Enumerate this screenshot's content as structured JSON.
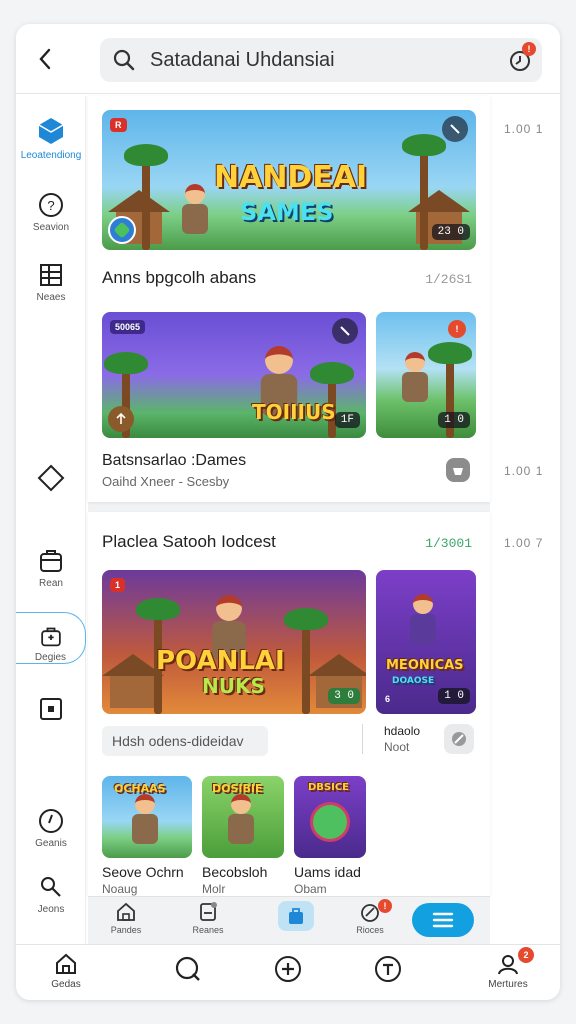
{
  "topbar": {
    "search_text": "Satadanai Uhdansiai"
  },
  "sidebar": {
    "items": [
      {
        "label": "Leoatendiong"
      },
      {
        "label": "Seavion"
      },
      {
        "label": "Neaes"
      },
      {
        "label": ""
      },
      {
        "label": "Rean"
      },
      {
        "label": "Degies"
      },
      {
        "label": ""
      },
      {
        "label": "Geanis"
      },
      {
        "label": "Jeons"
      }
    ]
  },
  "card1": {
    "hero": {
      "logo_line1": "NANDEAI",
      "logo_line2": "SAMES",
      "tag": "R",
      "counter": "23 0"
    },
    "title": "Anns bpgcolh abans",
    "meta": "1/26S1",
    "row2": {
      "tile_a": {
        "pill": "50065",
        "logo": "TOIIIUS",
        "counter": "1F"
      },
      "tile_b": {
        "counter": "1 0"
      }
    },
    "title2": "Batsnsarlao :Dames",
    "subtitle2": "Oaihd Xneer - Scesby"
  },
  "card2": {
    "title": "Placlea Satooh Iodcest",
    "meta": "1/3001",
    "hero": {
      "logo_line1": "POANLAI",
      "logo_line2": "NUKS",
      "tag": "1",
      "counter": "3 0"
    },
    "side": {
      "logo_line1": "MEONICAS",
      "logo_line2": "DOAOSE",
      "counter": "1 0",
      "num": "6"
    },
    "input_value": "Hdsh odens-dideidav",
    "side_label": "hdaolo",
    "side_sub": "Noot",
    "tiles": [
      {
        "logo": "OCHAAS",
        "title": "Seove Ochrn",
        "sub": "Noaug"
      },
      {
        "logo": "DOSIBIE",
        "title": "Becobsloh",
        "sub": "Molr"
      },
      {
        "logo": "DBSICE",
        "title": "Uams idad",
        "sub": "Obam"
      }
    ]
  },
  "dots": [
    "1.00 1",
    "1.00 1",
    "1.00 7"
  ],
  "innerbar": {
    "items": [
      {
        "label": "Pandes"
      },
      {
        "label": "Reanes"
      },
      {
        "label": ""
      },
      {
        "label": "Rioces"
      }
    ]
  },
  "bottomnav": {
    "items": [
      {
        "label": "Gedas"
      },
      {
        "label": ""
      },
      {
        "label": ""
      },
      {
        "label": ""
      },
      {
        "label": "Mertures"
      }
    ],
    "badge": "2"
  },
  "colors": {
    "accent": "#13a0e0",
    "badge": "#e64a2e",
    "sidebar_active": "#1e88d6"
  },
  "icons": [
    "back-icon",
    "search-icon",
    "notification-icon",
    "cube-icon",
    "help-icon",
    "list-icon",
    "diamond-icon",
    "store-icon",
    "bag-icon",
    "square-icon",
    "clock-icon",
    "magnifier-icon",
    "home-icon",
    "plus-icon",
    "profile-icon",
    "menu-icon"
  ]
}
